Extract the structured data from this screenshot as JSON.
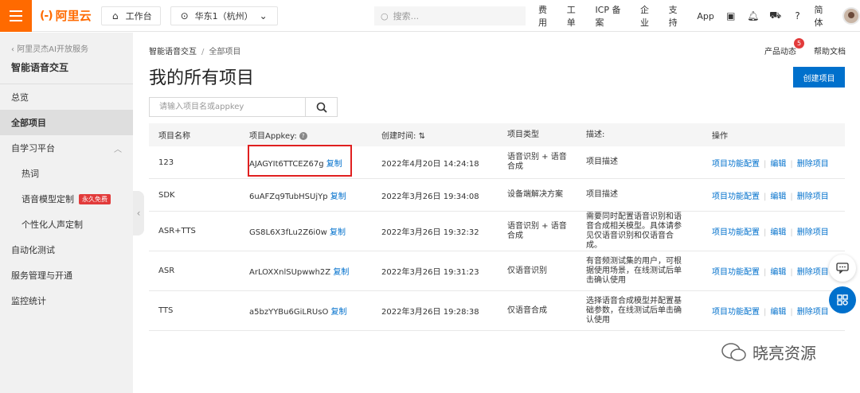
{
  "topbar": {
    "logo_mark": "(-)",
    "logo_text": "阿里云",
    "workbench": "工作台",
    "region": "华东1（杭州）",
    "search_placeholder": "搜索...",
    "links": [
      "费用",
      "工单",
      "ICP 备案",
      "企业",
      "支持",
      "App"
    ],
    "lang": "简体"
  },
  "sidebar": {
    "back": "阿里灵杰AI开放服务",
    "title": "智能语音交互",
    "items": [
      {
        "label": "总览"
      },
      {
        "label": "全部项目"
      },
      {
        "label": "自学习平台"
      },
      {
        "label": "热词"
      },
      {
        "label": "语音模型定制",
        "badge": "永久免费"
      },
      {
        "label": "个性化人声定制"
      },
      {
        "label": "自动化测试"
      },
      {
        "label": "服务管理与开通"
      },
      {
        "label": "监控统计"
      }
    ]
  },
  "main": {
    "breadcrumb": [
      "智能语音交互",
      "全部项目"
    ],
    "title": "我的所有项目",
    "product_news": "产品动态",
    "news_count": "5",
    "help_docs": "帮助文档",
    "create_button": "创建项目",
    "search_placeholder": "请输入项目名或appkey"
  },
  "table": {
    "headers": [
      "项目名称",
      "项目Appkey:",
      "创建时间:",
      "项目类型",
      "描述:",
      "操作"
    ],
    "copy_label": "复制",
    "ops": [
      "项目功能配置",
      "编辑",
      "删除项目"
    ],
    "rows": [
      {
        "name": "123",
        "appkey": "AJAGYIt6TTCEZ67g",
        "time": "2022年4月20日 14:24:18",
        "type": "语音识别 + 语音合成",
        "desc": "项目描述"
      },
      {
        "name": "SDK",
        "appkey": "6uAFZq9TubHSUjYp",
        "time": "2022年3月26日 19:34:08",
        "type": "设备端解决方案",
        "desc": "项目描述"
      },
      {
        "name": "ASR+TTS",
        "appkey": "GS8L6X3fLu2Z6i0w",
        "time": "2022年3月26日 19:32:32",
        "type": "语音识别 + 语音合成",
        "desc": "需要同时配置语音识别和语音合成相关模型。具体请参见仅语音识别和仅语音合成。"
      },
      {
        "name": "ASR",
        "appkey": "ArLOXXnlSUpwwh2Z",
        "time": "2022年3月26日 19:31:23",
        "type": "仅语音识别",
        "desc": "有音频测试集的用户，可根据使用场景，在线测试后单击确认使用"
      },
      {
        "name": "TTS",
        "appkey": "a5bzYYBu6GiLRUsO",
        "time": "2022年3月26日 19:28:38",
        "type": "仅语音合成",
        "desc": "选择语音合成模型并配置基础参数，在线测试后单击确认使用"
      }
    ]
  },
  "watermark": "晓亮资源"
}
